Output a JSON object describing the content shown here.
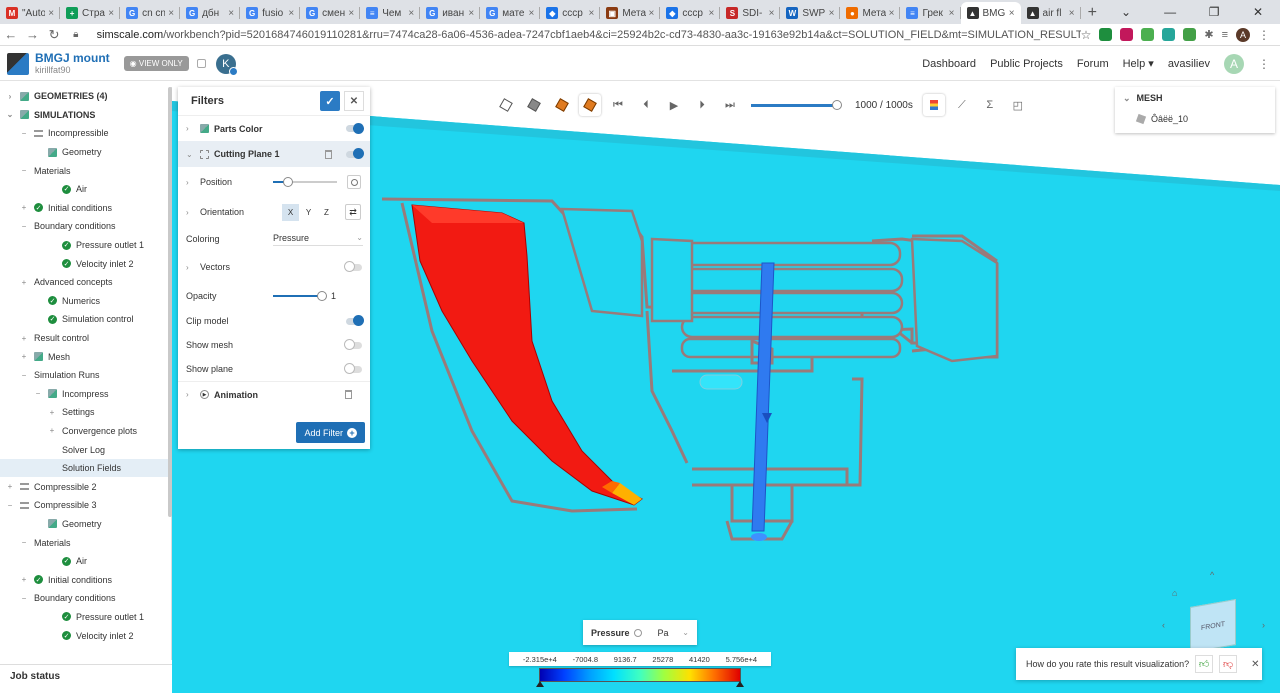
{
  "browser": {
    "tabs": [
      {
        "title": "\"Auto",
        "fav": "M",
        "color": "#d93025"
      },
      {
        "title": "Стра",
        "fav": "+",
        "color": "#0f9d58"
      },
      {
        "title": "cn cn",
        "fav": "G",
        "color": "#4285f4"
      },
      {
        "title": "дбн",
        "fav": "G",
        "color": "#4285f4"
      },
      {
        "title": "fusio",
        "fav": "G",
        "color": "#4285f4"
      },
      {
        "title": "смен",
        "fav": "G",
        "color": "#4285f4"
      },
      {
        "title": "Чем",
        "fav": "≡",
        "color": "#4285f4"
      },
      {
        "title": "иван",
        "fav": "G",
        "color": "#4285f4"
      },
      {
        "title": "мате",
        "fav": "G",
        "color": "#4285f4"
      },
      {
        "title": "cccp",
        "fav": "◆",
        "color": "#1a73e8"
      },
      {
        "title": "Мета",
        "fav": "▣",
        "color": "#8a3b12"
      },
      {
        "title": "cccp",
        "fav": "◆",
        "color": "#1a73e8"
      },
      {
        "title": "SDI-",
        "fav": "S",
        "color": "#c62828"
      },
      {
        "title": "SWP",
        "fav": "W",
        "color": "#1565c0"
      },
      {
        "title": "Мета",
        "fav": "●",
        "color": "#ef6c00"
      },
      {
        "title": "Грек",
        "fav": "≡",
        "color": "#4285f4"
      },
      {
        "title": "BMG",
        "fav": "▲",
        "color": "#333333",
        "active": true
      },
      {
        "title": "air fl",
        "fav": "▲",
        "color": "#333333"
      }
    ],
    "new_tab": "+",
    "url_prefix": "simscale.com",
    "url_rest": "/workbench?pid=5201684746019110281&rru=7474ca28-6a06-4536-adea-7247cbf1aeb4&ci=25924b2c-cd73-4830-aa3c-19163e92b14a&ct=SOLUTION_FIELD&mt=SIMULATION_RESULT",
    "profile_initial": "A"
  },
  "header": {
    "project_name": "BMGJ mount",
    "project_user": "kirillfat90",
    "view_only": "VIEW ONLY",
    "collab_initial": "K",
    "nav": [
      "Dashboard",
      "Public Projects",
      "Forum",
      "Help ▾",
      "avasiliev"
    ],
    "user_initial": "A"
  },
  "tree": [
    {
      "label": "GEOMETRIES (4)",
      "indent": 0,
      "bold": true,
      "exp": "›",
      "icon": "geo"
    },
    {
      "label": "SIMULATIONS",
      "indent": 0,
      "bold": true,
      "exp": "⌄",
      "icon": "geo"
    },
    {
      "label": "Incompressible",
      "indent": 1,
      "exp": "−",
      "icon": "list"
    },
    {
      "label": "Geometry",
      "indent": 2,
      "exp": "",
      "icon": "geo"
    },
    {
      "label": "Materials",
      "indent": 1,
      "exp": "−",
      "icon": "none"
    },
    {
      "label": "Air",
      "indent": 3,
      "exp": "",
      "icon": "ok"
    },
    {
      "label": "Initial conditions",
      "indent": 1,
      "exp": "+",
      "icon": "ok"
    },
    {
      "label": "Boundary conditions",
      "indent": 1,
      "exp": "−",
      "icon": "none"
    },
    {
      "label": "Pressure outlet 1",
      "indent": 3,
      "exp": "",
      "icon": "ok"
    },
    {
      "label": "Velocity inlet 2",
      "indent": 3,
      "exp": "",
      "icon": "ok"
    },
    {
      "label": "Advanced concepts",
      "indent": 1,
      "exp": "+",
      "icon": "none"
    },
    {
      "label": "Numerics",
      "indent": 2,
      "exp": "",
      "icon": "ok"
    },
    {
      "label": "Simulation control",
      "indent": 2,
      "exp": "",
      "icon": "ok"
    },
    {
      "label": "Result control",
      "indent": 1,
      "exp": "+",
      "icon": "none"
    },
    {
      "label": "Mesh",
      "indent": 1,
      "exp": "+",
      "icon": "geo"
    },
    {
      "label": "Simulation Runs",
      "indent": 1,
      "exp": "−",
      "icon": "none"
    },
    {
      "label": "Incompress",
      "indent": 2,
      "exp": "−",
      "icon": "geo"
    },
    {
      "label": "Settings",
      "indent": 3,
      "exp": "+",
      "icon": "none"
    },
    {
      "label": "Convergence plots",
      "indent": 3,
      "exp": "+",
      "icon": "none"
    },
    {
      "label": "Solver Log",
      "indent": 3,
      "exp": "",
      "icon": "none"
    },
    {
      "label": "Solution Fields",
      "indent": 3,
      "exp": "",
      "icon": "none",
      "selected": true
    },
    {
      "label": "Compressible 2",
      "indent": 0,
      "exp": "+",
      "icon": "list"
    },
    {
      "label": "Compressible 3",
      "indent": 0,
      "exp": "−",
      "icon": "list"
    },
    {
      "label": "Geometry",
      "indent": 2,
      "exp": "",
      "icon": "geo"
    },
    {
      "label": "Materials",
      "indent": 1,
      "exp": "−",
      "icon": "none"
    },
    {
      "label": "Air",
      "indent": 3,
      "exp": "",
      "icon": "ok"
    },
    {
      "label": "Initial conditions",
      "indent": 1,
      "exp": "+",
      "icon": "ok"
    },
    {
      "label": "Boundary conditions",
      "indent": 1,
      "exp": "−",
      "icon": "none"
    },
    {
      "label": "Pressure outlet 1",
      "indent": 3,
      "exp": "",
      "icon": "ok"
    },
    {
      "label": "Velocity inlet 2",
      "indent": 3,
      "exp": "",
      "icon": "ok"
    }
  ],
  "job_status": "Job status",
  "toolbar": {
    "frame": "1000 / 1000s",
    "sigma": "Σ"
  },
  "filters": {
    "title": "Filters",
    "parts_color": "Parts Color",
    "cutting_plane": "Cutting Plane 1",
    "position": "Position",
    "orientation": "Orientation",
    "axes": [
      "X",
      "Y",
      "Z"
    ],
    "coloring_label": "Coloring",
    "coloring_value": "Pressure",
    "vectors": "Vectors",
    "opacity_label": "Opacity",
    "opacity_value": "1",
    "clip_model": "Clip model",
    "show_mesh": "Show mesh",
    "show_plane": "Show plane",
    "animation": "Animation",
    "add_filter": "Add Filter"
  },
  "mesh_panel": {
    "title": "MESH",
    "item": "Ôâëë_10"
  },
  "legend": {
    "quantity": "Pressure",
    "unit": "Pa",
    "ticks": [
      "-2.315e+4",
      "-7004.8",
      "9136.7",
      "25278",
      "41420",
      "5.756e+4"
    ]
  },
  "rating": {
    "question": "How do you rate this result visualization?"
  },
  "navcube": {
    "face": "FRONT"
  }
}
